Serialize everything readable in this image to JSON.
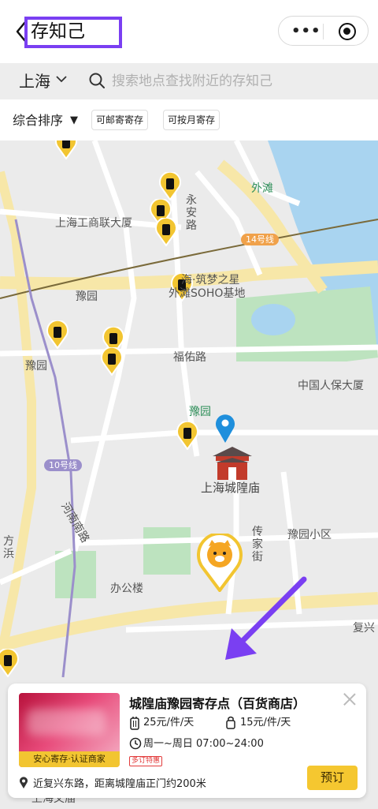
{
  "header": {
    "title": "存知己",
    "colors": {
      "highlight": "#7a3ff2"
    }
  },
  "search": {
    "city": "上海",
    "placeholder": "搜索地点查找附近的存知己"
  },
  "filters": {
    "sort_label": "综合排序",
    "sort_arrow": "▼",
    "chips": [
      "可邮寄寄存",
      "可按月寄存"
    ]
  },
  "map": {
    "labels": {
      "waitan": "外滩",
      "gongshang": "上海工商联大厦",
      "yongan": "永安路",
      "line14": "14号线",
      "zhumeng": "海·筑梦之星",
      "soho": "外滩SOHO基地",
      "yuyuan_station1": "豫园",
      "yuyuan_station2": "豫园",
      "fuyou": "福佑路",
      "renbao": "中国人保大厦",
      "yuyuan_garden": "豫园",
      "line10": "10号线",
      "chenghuangmiao": "上海城隍庙",
      "henan": "河南南路",
      "fangbang": "方浜",
      "chuanjia": "传家街",
      "yuyuan_xiaoqu": "豫园小区",
      "bangonglou": "办公楼",
      "fuxing": "复兴",
      "bottom": "上海文庙"
    },
    "colors": {
      "water": "#a9d4f0",
      "park": "#bde3bf",
      "road": "#ffffff",
      "major_road": "#f7e7a8",
      "pin": "#f2c531",
      "marker": "#1f8fdc",
      "arrow": "#7a3ff2"
    }
  },
  "card": {
    "name": "城隍庙豫园寄存点（百货商店）",
    "badge": "安心寄存·认证商家",
    "price_large": "25元/件/天",
    "price_small": "15元/件/天",
    "hours": "周一~周日 07:00~24:00",
    "promo": "多订特惠",
    "address": "近复兴东路，距离城隍庙正门约200米",
    "book_button": "预订",
    "icons": [
      "luggage-large-icon",
      "luggage-small-icon",
      "clock-icon",
      "location-pin-icon",
      "close-icon"
    ]
  }
}
